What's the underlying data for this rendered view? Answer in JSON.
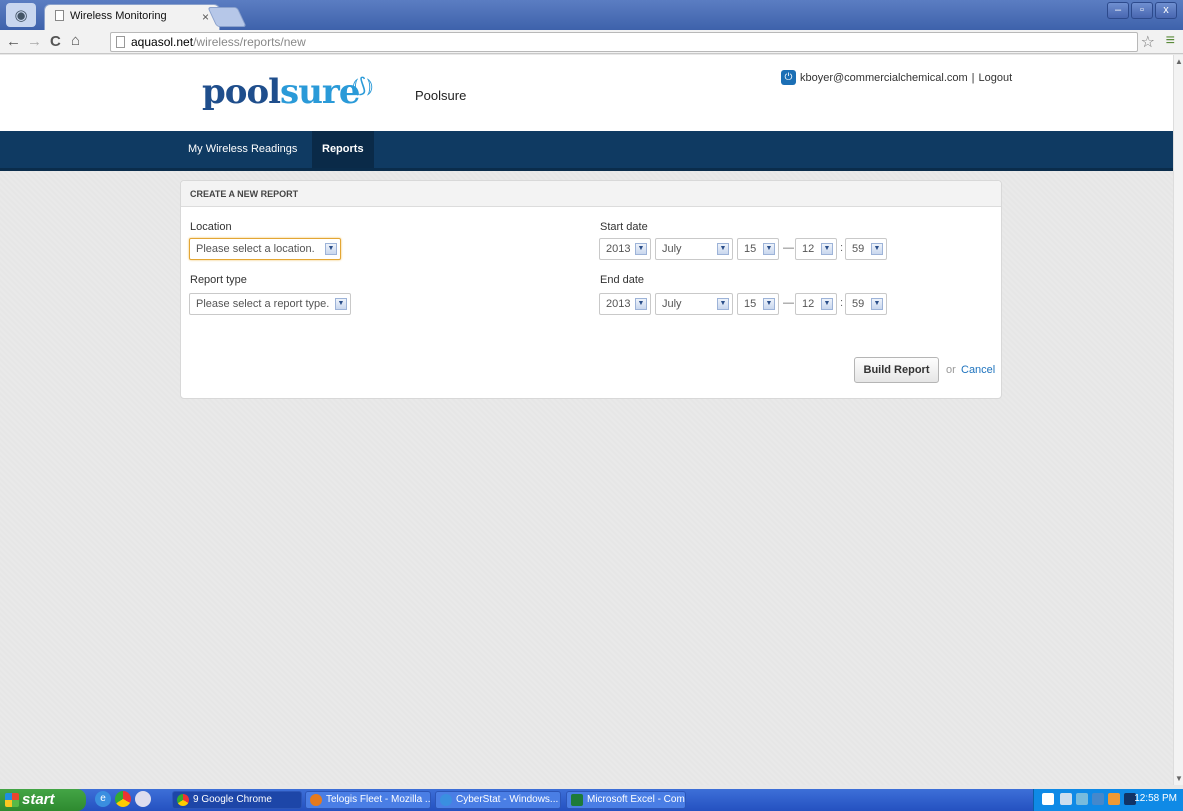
{
  "browser": {
    "tab_title": "Wireless Monitoring",
    "tab_close": "×",
    "url_host": "aquasol.net",
    "url_path": "/wireless/reports/new",
    "window_controls": [
      "–",
      "▫",
      "x"
    ]
  },
  "header": {
    "logo_part1": "pool",
    "logo_part2": "sure",
    "site_name": "Poolsure",
    "user_email": "kboyer@commercialchemical.com",
    "separator": "|",
    "logout_label": "Logout"
  },
  "nav": {
    "items": [
      {
        "label": "My Wireless Readings"
      },
      {
        "label": "Reports"
      }
    ]
  },
  "form": {
    "panel_title": "CREATE A NEW REPORT",
    "location_label": "Location",
    "location_value": "Please select a location.",
    "report_type_label": "Report type",
    "report_type_value": "Please select a report type.",
    "start_label": "Start date",
    "end_label": "End date",
    "start": {
      "year": "2013",
      "month": "July",
      "day": "15",
      "hour": "12",
      "minute": "59"
    },
    "end": {
      "year": "2013",
      "month": "July",
      "day": "15",
      "hour": "12",
      "minute": "59"
    },
    "dash": "—",
    "colon": ":",
    "build_label": "Build Report",
    "or_label": "or",
    "cancel_label": "Cancel"
  },
  "taskbar": {
    "start_label": "start",
    "tasks": [
      {
        "label": "9 Google Chrome"
      },
      {
        "label": "Telogis Fleet - Mozilla ..."
      },
      {
        "label": "CyberStat - Windows..."
      },
      {
        "label": "Microsoft Excel - Com..."
      }
    ],
    "clock": "12:58 PM"
  },
  "colors": {
    "nav_bg": "#0f3a62",
    "link": "#1e73be",
    "focus_border": "#e3a634",
    "logo_blue": "#1f4e8c",
    "logo_light_blue": "#2a9ad8"
  }
}
